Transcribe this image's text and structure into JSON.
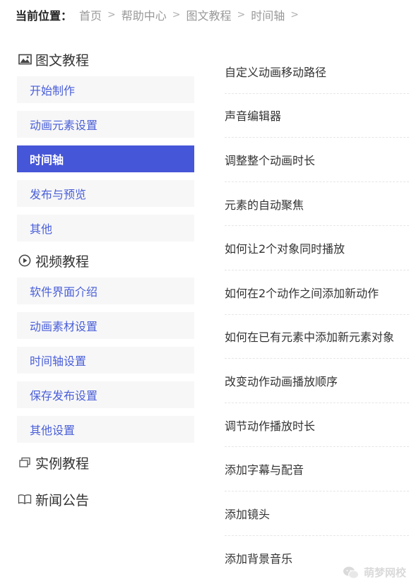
{
  "breadcrumb": {
    "label": "当前位置：",
    "items": [
      "首页",
      "帮助中心",
      "图文教程",
      "时间轴"
    ],
    "separator": ">"
  },
  "sidebar": {
    "sections": [
      {
        "title": "图文教程",
        "icon": "image-icon",
        "items": [
          {
            "label": "开始制作",
            "active": false
          },
          {
            "label": "动画元素设置",
            "active": false
          },
          {
            "label": "时间轴",
            "active": true
          },
          {
            "label": "发布与预览",
            "active": false
          },
          {
            "label": "其他",
            "active": false
          }
        ]
      },
      {
        "title": "视频教程",
        "icon": "play-circle-icon",
        "items": [
          {
            "label": "软件界面介绍",
            "active": false
          },
          {
            "label": "动画素材设置",
            "active": false
          },
          {
            "label": "时间轴设置",
            "active": false
          },
          {
            "label": "保存发布设置",
            "active": false
          },
          {
            "label": "其他设置",
            "active": false
          }
        ]
      },
      {
        "title": "实例教程",
        "icon": "stack-icon",
        "items": []
      },
      {
        "title": "新闻公告",
        "icon": "open-book-icon",
        "items": []
      }
    ]
  },
  "articles": [
    "自定义动画移动路径",
    "声音编辑器",
    "调整整个动画时长",
    "元素的自动聚焦",
    "如何让2个对象同时播放",
    "如何在2个动作之间添加新动作",
    "如何在已有元素中添加新元素对象",
    "改变动作动画播放顺序",
    "调节动作播放时长",
    "添加字幕与配音",
    "添加镜头",
    "添加背景音乐"
  ],
  "watermark": {
    "text": "萌梦网校",
    "icon": "wechat-icon"
  },
  "colors": {
    "accent": "#4656d8",
    "link": "#4a5fd8",
    "item_bg": "#f7f7f8",
    "muted": "#999999"
  }
}
